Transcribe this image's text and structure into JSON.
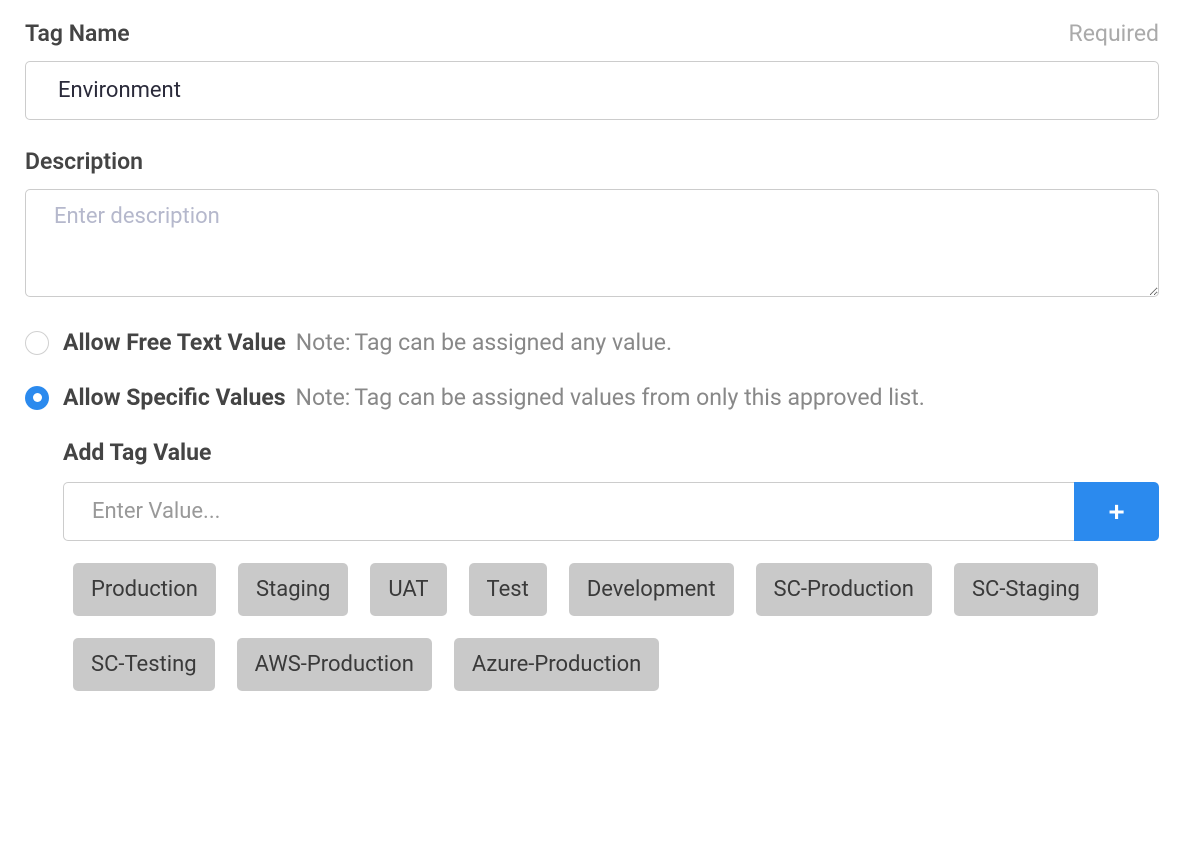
{
  "tagName": {
    "label": "Tag Name",
    "requiredText": "Required",
    "value": "Environment"
  },
  "description": {
    "label": "Description",
    "placeholder": "Enter description",
    "value": ""
  },
  "valueMode": {
    "options": [
      {
        "label": "Allow Free Text Value",
        "notePrefix": "Note:",
        "note": "Tag can be assigned any value.",
        "selected": false
      },
      {
        "label": "Allow Specific Values",
        "notePrefix": "Note:",
        "note": "Tag can be assigned values from only this approved list.",
        "selected": true
      }
    ]
  },
  "addTagValue": {
    "label": "Add Tag Value",
    "placeholder": "Enter Value...",
    "value": ""
  },
  "tagValues": [
    "Production",
    "Staging",
    "UAT",
    "Test",
    "Development",
    "SC-Production",
    "SC-Staging",
    "SC-Testing",
    "AWS-Production",
    "Azure-Production"
  ]
}
